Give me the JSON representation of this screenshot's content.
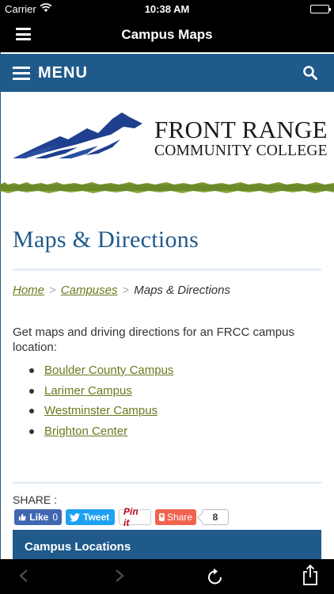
{
  "status_bar": {
    "carrier": "Carrier",
    "time": "10:38 AM"
  },
  "nav": {
    "title": "Campus Maps"
  },
  "site": {
    "menu_label": "MENU",
    "college_name_line1": "FRONT RANGE",
    "college_name_line2": "COMMUNITY COLLEGE",
    "brand_color": "#1f5a8a",
    "link_color": "#6b7a1e"
  },
  "page": {
    "title": "Maps & Directions",
    "breadcrumb": {
      "home": "Home",
      "sep1": ">",
      "campuses": "Campuses",
      "sep2": ">",
      "current": "Maps & Directions"
    },
    "intro": "Get maps and driving directions for an FRCC campus location:",
    "campuses": [
      {
        "label": "Boulder County Campus"
      },
      {
        "label": "Larimer Campus"
      },
      {
        "label": "Westminster Campus"
      },
      {
        "label": "Brighton Center"
      }
    ]
  },
  "share": {
    "label": "SHARE :",
    "like_label": "Like",
    "like_count": "0",
    "tweet_label": "Tweet",
    "pin_label": "Pin it",
    "share_label": "Share",
    "share_count": "8"
  },
  "section": {
    "campus_locations": "Campus Locations"
  },
  "icons": [
    "wifi-icon",
    "battery-icon",
    "hamburger-icon",
    "search-icon",
    "back-arrow-icon",
    "forward-arrow-icon",
    "reload-icon",
    "share-icon",
    "facebook-icon",
    "twitter-icon",
    "plus-icon"
  ]
}
